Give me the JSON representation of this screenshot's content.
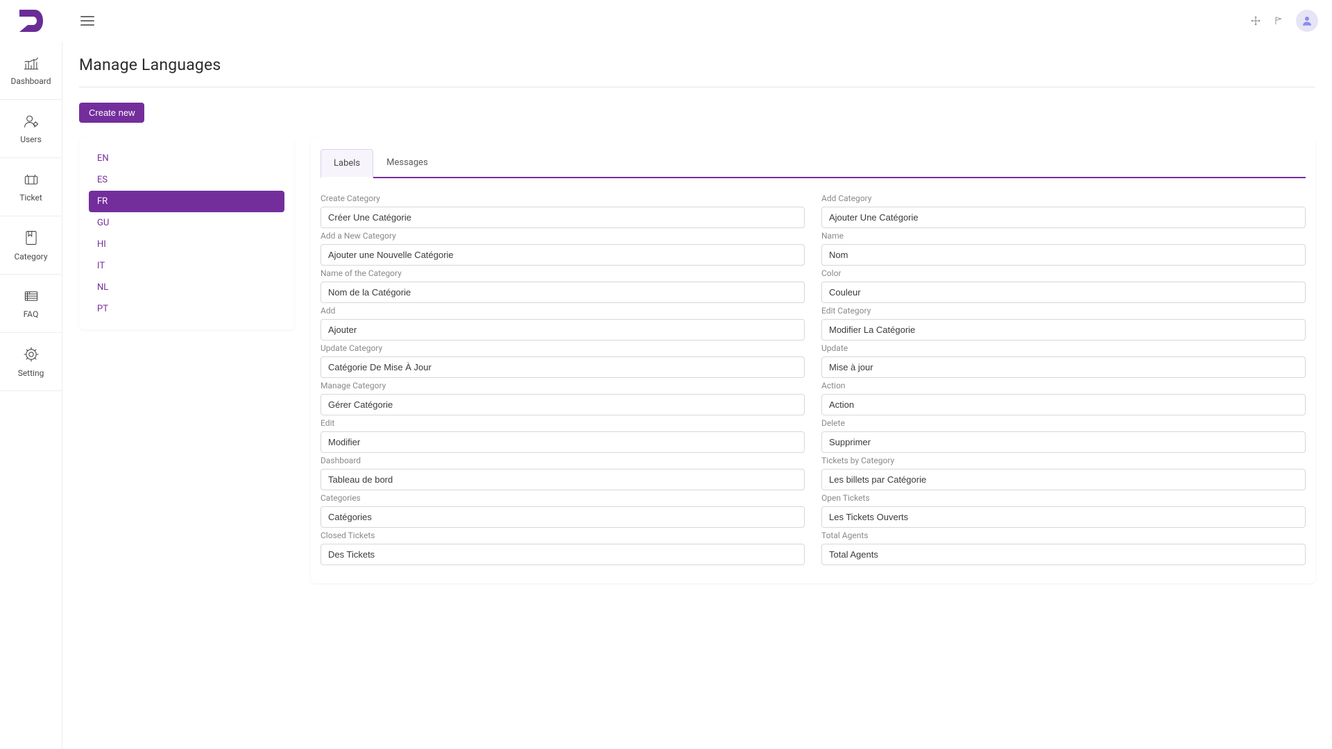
{
  "colors": {
    "accent": "#732e9c"
  },
  "sidebar": {
    "items": [
      {
        "label": "Dashboard"
      },
      {
        "label": "Users"
      },
      {
        "label": "Ticket"
      },
      {
        "label": "Category"
      },
      {
        "label": "FAQ"
      },
      {
        "label": "Setting"
      }
    ]
  },
  "page": {
    "title": "Manage Languages",
    "createButton": "Create new"
  },
  "languages": {
    "items": [
      "EN",
      "ES",
      "FR",
      "GU",
      "HI",
      "IT",
      "NL",
      "PT"
    ],
    "activeIndex": 2
  },
  "tabs": {
    "labels": "Labels",
    "messages": "Messages",
    "activeIndex": 0
  },
  "fields": {
    "left": [
      {
        "label": "Create Category",
        "value": "Créer Une Catégorie"
      },
      {
        "label": "Add a New Category",
        "value": "Ajouter une Nouvelle Catégorie"
      },
      {
        "label": "Name of the Category",
        "value": "Nom de la Catégorie"
      },
      {
        "label": "Add",
        "value": "Ajouter"
      },
      {
        "label": "Update Category",
        "value": "Catégorie De Mise À Jour"
      },
      {
        "label": "Manage Category",
        "value": "Gérer Catégorie"
      },
      {
        "label": "Edit",
        "value": "Modifier"
      },
      {
        "label": "Dashboard",
        "value": "Tableau de bord"
      },
      {
        "label": "Categories",
        "value": "Catégories"
      },
      {
        "label": "Closed Tickets",
        "value": "Des Tickets"
      }
    ],
    "right": [
      {
        "label": "Add Category",
        "value": "Ajouter Une Catégorie"
      },
      {
        "label": "Name",
        "value": "Nom"
      },
      {
        "label": "Color",
        "value": "Couleur"
      },
      {
        "label": "Edit Category",
        "value": "Modifier La Catégorie"
      },
      {
        "label": "Update",
        "value": "Mise à jour"
      },
      {
        "label": "Action",
        "value": "Action"
      },
      {
        "label": "Delete",
        "value": "Supprimer"
      },
      {
        "label": "Tickets by Category",
        "value": "Les billets par Catégorie"
      },
      {
        "label": "Open Tickets",
        "value": "Les Tickets Ouverts"
      },
      {
        "label": "Total Agents",
        "value": "Total Agents"
      }
    ]
  }
}
